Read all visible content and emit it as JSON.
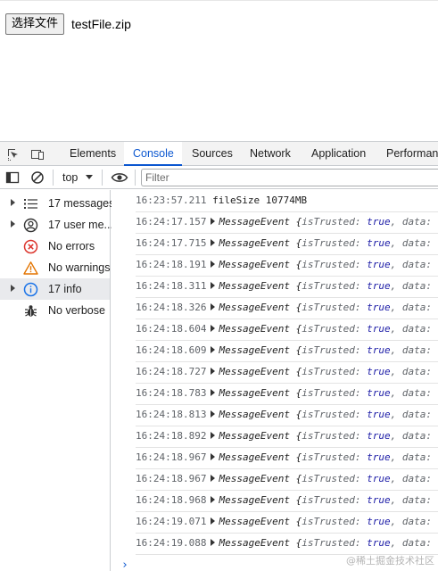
{
  "page": {
    "file_button_label": "选择文件",
    "file_name": "testFile.zip"
  },
  "devtools": {
    "tabs": [
      {
        "label": "Elements"
      },
      {
        "label": "Console"
      },
      {
        "label": "Sources"
      },
      {
        "label": "Network"
      },
      {
        "label": "Application"
      },
      {
        "label": "Performance"
      }
    ],
    "active_tab": "Console",
    "toolbar": {
      "context": "top",
      "filter_placeholder": "Filter"
    },
    "sidebar": {
      "items": [
        {
          "label": "17 messages",
          "icon": "list-icon",
          "expandable": true
        },
        {
          "label": "17 user me...",
          "icon": "user-icon",
          "expandable": true
        },
        {
          "label": "No errors",
          "icon": "error-icon",
          "expandable": false
        },
        {
          "label": "No warnings",
          "icon": "warning-icon",
          "expandable": false
        },
        {
          "label": "17 info",
          "icon": "info-icon",
          "expandable": true,
          "selected": true
        },
        {
          "label": "No verbose",
          "icon": "bug-icon",
          "expandable": false
        }
      ]
    },
    "console": {
      "messages": [
        {
          "time": "16:23:57.211",
          "text": "fileSize 10774MB"
        },
        {
          "time": "16:24:17.157",
          "obj": "MessageEvent"
        },
        {
          "time": "16:24:17.715",
          "obj": "MessageEvent"
        },
        {
          "time": "16:24:18.191",
          "obj": "MessageEvent"
        },
        {
          "time": "16:24:18.311",
          "obj": "MessageEvent"
        },
        {
          "time": "16:24:18.326",
          "obj": "MessageEvent"
        },
        {
          "time": "16:24:18.604",
          "obj": "MessageEvent"
        },
        {
          "time": "16:24:18.609",
          "obj": "MessageEvent"
        },
        {
          "time": "16:24:18.727",
          "obj": "MessageEvent"
        },
        {
          "time": "16:24:18.783",
          "obj": "MessageEvent"
        },
        {
          "time": "16:24:18.813",
          "obj": "MessageEvent"
        },
        {
          "time": "16:24:18.892",
          "obj": "MessageEvent"
        },
        {
          "time": "16:24:18.967",
          "obj": "MessageEvent"
        },
        {
          "time": "16:24:18.967",
          "obj": "MessageEvent"
        },
        {
          "time": "16:24:18.968",
          "obj": "MessageEvent"
        },
        {
          "time": "16:24:19.071",
          "obj": "MessageEvent"
        },
        {
          "time": "16:24:19.088",
          "obj": "MessageEvent"
        }
      ],
      "event_preview": {
        "open_brace": "{",
        "key1": "isTrusted",
        "colon": ":",
        "val1": "true",
        "comma": ",",
        "key2": "data",
        "colon2": ":"
      },
      "prompt": "›"
    },
    "colors": {
      "accent": "#0b57d0",
      "error": "#dc362e",
      "warning": "#e37400",
      "info": "#1a73e8"
    }
  },
  "watermark": "@稀土掘金技术社区"
}
